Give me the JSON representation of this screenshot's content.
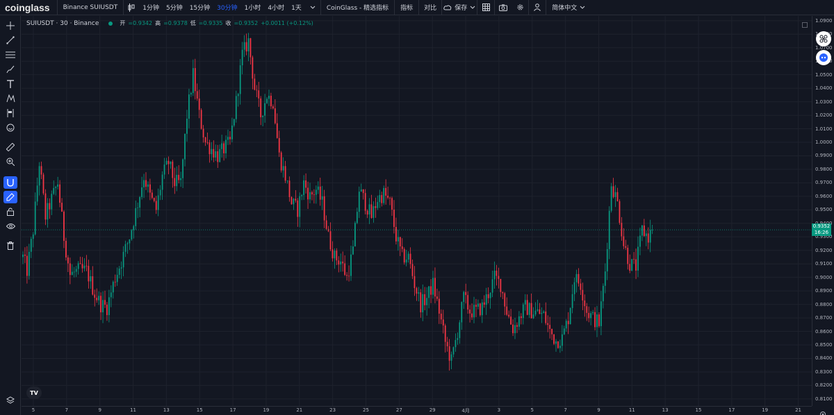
{
  "topbar": {
    "logo": "coinglass",
    "symbol": "Binance SUIUSDT",
    "intervals": [
      "1分钟",
      "5分钟",
      "15分钟",
      "30分钟",
      "1小时",
      "4小时",
      "1天"
    ],
    "active_interval": "30分钟",
    "indicator_preset": "CoinGlass - 精选指标",
    "indicators_label": "指标",
    "compare_label": "对比",
    "save_label": "保存",
    "language_label": "简体中文"
  },
  "legend": {
    "symbol": "SUIUSDT · 30 · Binance",
    "open_label": "开",
    "open_value": "=0.9342",
    "high_label": "高",
    "high_value": "=0.9378",
    "low_label": "低",
    "low_value": "=0.9335",
    "close_label": "收",
    "close_value": "=0.9352",
    "change": "+0.0011 (+0.12%)"
  },
  "price_tag": {
    "price": "0.9352",
    "countdown": "16:26"
  },
  "tv_badge": "TV",
  "colors": {
    "up": "#089981",
    "down": "#f23645",
    "background": "#131722",
    "accent": "#2962ff"
  },
  "chart_data": {
    "type": "candlestick",
    "symbol": "SUIUSDT",
    "interval": "30",
    "exchange": "Binance",
    "y_ticks": [
      "1.0900",
      "1.0800",
      "1.0700",
      "1.0600",
      "1.0500",
      "1.0400",
      "1.0300",
      "1.0200",
      "1.0100",
      "1.0000",
      "0.9900",
      "0.9800",
      "0.9700",
      "0.9600",
      "0.9500",
      "0.9400",
      "0.9300",
      "0.9200",
      "0.9100",
      "0.9000",
      "0.8900",
      "0.8800",
      "0.8700",
      "0.8600",
      "0.8500",
      "0.8400",
      "0.8300",
      "0.8200",
      "0.8100"
    ],
    "x_ticks": [
      "5",
      "7",
      "9",
      "11",
      "13",
      "15",
      "17",
      "19",
      "21",
      "23",
      "25",
      "27",
      "29",
      "4月",
      "3",
      "5",
      "7",
      "9",
      "11",
      "13",
      "15",
      "17",
      "19",
      "21"
    ],
    "ylim": [
      0.8048,
      1.0935
    ],
    "current_price": 0.9352,
    "price_path": [
      [
        0,
        0.915
      ],
      [
        2,
        0.905
      ],
      [
        5,
        0.935
      ],
      [
        8,
        0.985
      ],
      [
        11,
        0.945
      ],
      [
        14,
        0.958
      ],
      [
        17,
        0.97
      ],
      [
        20,
        0.93
      ],
      [
        23,
        0.902
      ],
      [
        27,
        0.905
      ],
      [
        31,
        0.905
      ],
      [
        35,
        0.888
      ],
      [
        38,
        0.88
      ],
      [
        41,
        0.878
      ],
      [
        45,
        0.9
      ],
      [
        48,
        0.912
      ],
      [
        52,
        0.93
      ],
      [
        56,
        0.955
      ],
      [
        59,
        0.975
      ],
      [
        62,
        0.96
      ],
      [
        65,
        0.95
      ],
      [
        68,
        0.975
      ],
      [
        71,
        0.985
      ],
      [
        74,
        0.97
      ],
      [
        77,
        0.97
      ],
      [
        80,
        1.02
      ],
      [
        83,
        1.05
      ],
      [
        86,
        1.02
      ],
      [
        89,
        1.0
      ],
      [
        92,
        0.995
      ],
      [
        95,
        0.99
      ],
      [
        98,
        0.995
      ],
      [
        101,
        1.0
      ],
      [
        104,
        1.03
      ],
      [
        107,
        1.065
      ],
      [
        110,
        1.075
      ],
      [
        113,
        1.04
      ],
      [
        116,
        1.02
      ],
      [
        119,
        1.035
      ],
      [
        122,
        1.03
      ],
      [
        125,
        0.99
      ],
      [
        128,
        0.975
      ],
      [
        131,
        0.955
      ],
      [
        134,
        0.95
      ],
      [
        137,
        0.97
      ],
      [
        140,
        0.96
      ],
      [
        143,
        0.965
      ],
      [
        146,
        0.955
      ],
      [
        149,
        0.93
      ],
      [
        152,
        0.915
      ],
      [
        155,
        0.912
      ],
      [
        158,
        0.9
      ],
      [
        161,
        0.92
      ],
      [
        164,
        0.965
      ],
      [
        167,
        0.955
      ],
      [
        170,
        0.945
      ],
      [
        173,
        0.958
      ],
      [
        176,
        0.962
      ],
      [
        179,
        0.955
      ],
      [
        182,
        0.93
      ],
      [
        185,
        0.915
      ],
      [
        188,
        0.915
      ],
      [
        191,
        0.895
      ],
      [
        194,
        0.88
      ],
      [
        197,
        0.885
      ],
      [
        200,
        0.895
      ],
      [
        203,
        0.875
      ],
      [
        206,
        0.852
      ],
      [
        209,
        0.838
      ],
      [
        212,
        0.86
      ],
      [
        215,
        0.885
      ],
      [
        218,
        0.875
      ],
      [
        221,
        0.875
      ],
      [
        224,
        0.878
      ],
      [
        227,
        0.888
      ],
      [
        230,
        0.9
      ],
      [
        233,
        0.895
      ],
      [
        236,
        0.875
      ],
      [
        239,
        0.862
      ],
      [
        242,
        0.87
      ],
      [
        245,
        0.878
      ],
      [
        248,
        0.875
      ],
      [
        251,
        0.874
      ],
      [
        254,
        0.872
      ],
      [
        257,
        0.86
      ],
      [
        260,
        0.853
      ],
      [
        263,
        0.855
      ],
      [
        266,
        0.87
      ],
      [
        269,
        0.9
      ],
      [
        272,
        0.895
      ],
      [
        275,
        0.875
      ],
      [
        278,
        0.87
      ],
      [
        281,
        0.866
      ],
      [
        284,
        0.905
      ],
      [
        287,
        0.97
      ],
      [
        290,
        0.955
      ],
      [
        293,
        0.925
      ],
      [
        296,
        0.91
      ],
      [
        299,
        0.908
      ],
      [
        302,
        0.935
      ],
      [
        305,
        0.93
      ],
      [
        307,
        0.9352
      ]
    ]
  }
}
